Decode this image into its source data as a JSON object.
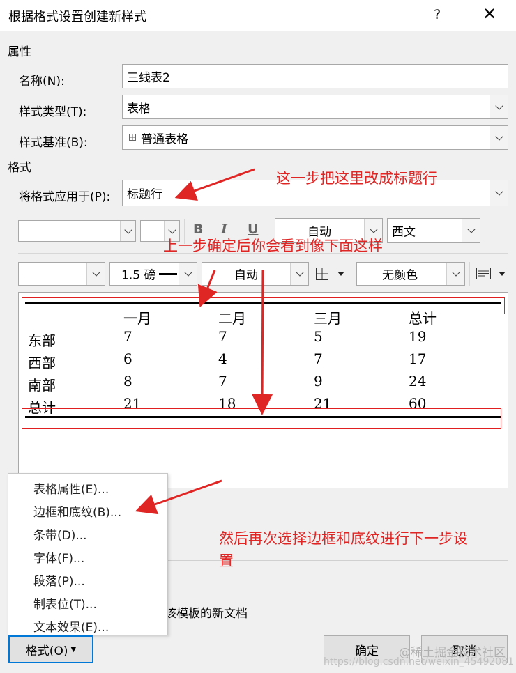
{
  "dialog": {
    "title": "根据格式设置创建新样式",
    "help": "?",
    "close": "✕"
  },
  "properties": {
    "section_label": "属性",
    "name_label": "名称(N):",
    "name_value": "三线表2",
    "style_type_label": "样式类型(T):",
    "style_type_value": "表格",
    "style_based_label": "样式基准(B):",
    "style_based_value": "普通表格"
  },
  "format": {
    "section_label": "格式",
    "apply_to_label": "将格式应用于(P):",
    "apply_to_value": "标题行",
    "toolbar1": {
      "font_value": "",
      "size_value": "",
      "bold": "B",
      "italic": "I",
      "underline": "U",
      "color_value": "自动",
      "script_value": "西文"
    },
    "toolbar2": {
      "line_width_value": "1.5 磅",
      "border_color_value": "自动",
      "shading_value": "无颜色"
    }
  },
  "preview_table": {
    "headers": [
      "一月",
      "二月",
      "三月",
      "总计"
    ],
    "rows": [
      {
        "label": "东部",
        "values": [
          "7",
          "7",
          "5",
          "19"
        ]
      },
      {
        "label": "西部",
        "values": [
          "6",
          "4",
          "7",
          "17"
        ]
      },
      {
        "label": "南部",
        "values": [
          "8",
          "7",
          "9",
          "24"
        ]
      },
      {
        "label": "总计",
        "values": [
          "21",
          "18",
          "21",
          "60"
        ]
      }
    ]
  },
  "annotations": {
    "a1": "这一步把这里改成标题行",
    "a2": "上一步确定后你会看到像下面这样",
    "a3_line1": "然后再次选择边框和底纹进行下一步设",
    "a3_line2": "置"
  },
  "format_menu": {
    "items": [
      "表格属性(E)...",
      "边框和底纹(B)...",
      "条带(D)...",
      "字体(F)...",
      "段落(P)...",
      "制表位(T)...",
      "文本效果(E)..."
    ]
  },
  "bottom": {
    "partial_text": "该模板的新文档",
    "format_button": "格式(O)",
    "ok_button": "确定",
    "cancel_button": "取消",
    "watermark_logo": "@稀土掘金技术社区",
    "watermark_url": "https://blog.csdn.net/weixin_45492081"
  },
  "colors": {
    "annotation_red": "#e02525",
    "focus_blue": "#0078d7"
  }
}
